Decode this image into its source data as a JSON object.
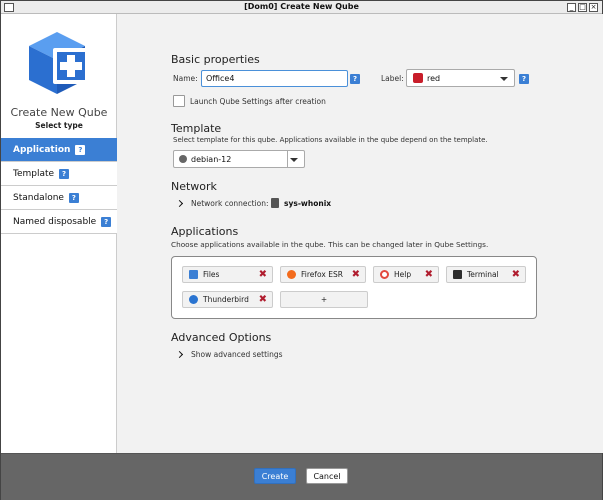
{
  "window": {
    "title": "[Dom0] Create New Qube"
  },
  "sidebar": {
    "title": "Create New Qube",
    "subtitle": "Select type",
    "items": [
      {
        "label": "Application",
        "help": "?"
      },
      {
        "label": "Template",
        "help": "?"
      },
      {
        "label": "Standalone",
        "help": "?"
      },
      {
        "label": "Named disposable",
        "help": "?"
      }
    ]
  },
  "basic": {
    "heading": "Basic properties",
    "name_label": "Name:",
    "name_value": "Office4",
    "label_label": "Label:",
    "label_value": "red",
    "label_color": "#c81d2a",
    "launch_settings": "Launch Qube Settings after creation",
    "help": "?"
  },
  "template": {
    "heading": "Template",
    "description": "Select template for this qube. Applications available in the qube depend on the template.",
    "value": "debian-12"
  },
  "network": {
    "heading": "Network",
    "label": "Network connection:",
    "value": "sys-whonix"
  },
  "applications": {
    "heading": "Applications",
    "description": "Choose applications available in the qube. This can be changed later in Qube Settings.",
    "items": [
      {
        "label": "Files",
        "icon": "files-icon"
      },
      {
        "label": "Firefox ESR",
        "icon": "firefox-icon"
      },
      {
        "label": "Help",
        "icon": "help-icon"
      },
      {
        "label": "Terminal",
        "icon": "terminal-icon"
      },
      {
        "label": "Thunderbird",
        "icon": "thunderbird-icon"
      }
    ],
    "add_label": "+",
    "remove_glyph": "✖"
  },
  "advanced": {
    "heading": "Advanced Options",
    "toggle": "Show advanced settings"
  },
  "footer": {
    "create": "Create",
    "cancel": "Cancel"
  },
  "colors": {
    "accent": "#3b7fd4",
    "remove": "#b01c2e",
    "footer": "#666666"
  }
}
